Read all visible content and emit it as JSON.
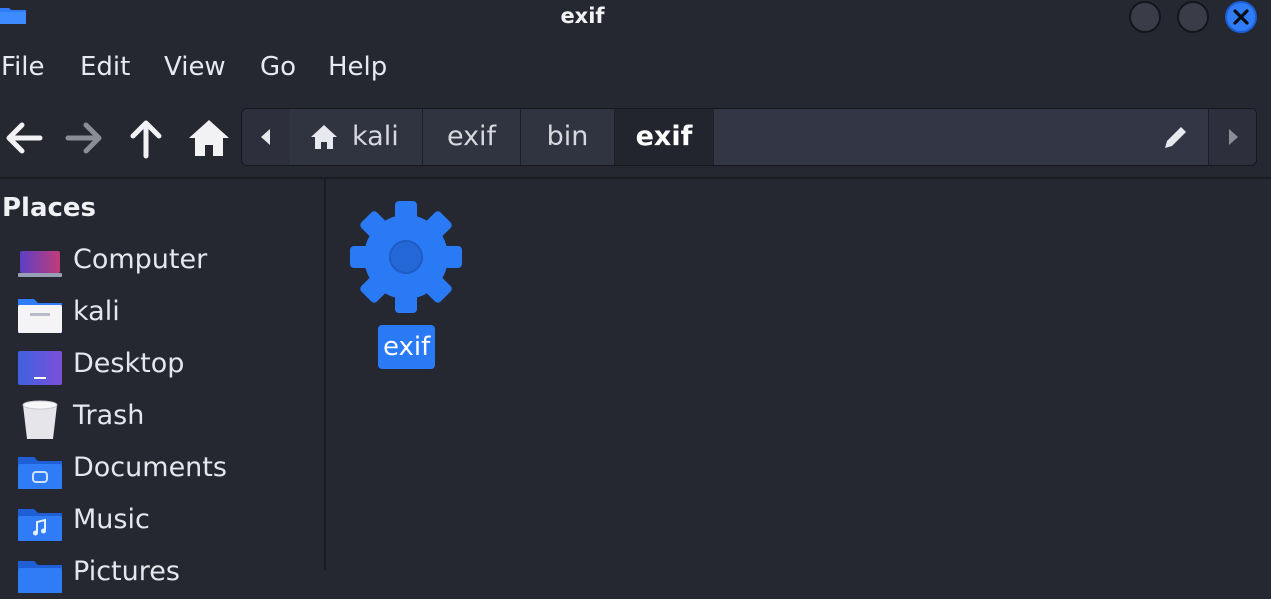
{
  "window": {
    "title": "exif"
  },
  "menu": {
    "file": "File",
    "edit": "Edit",
    "view": "View",
    "go": "Go",
    "help": "Help"
  },
  "path": {
    "segments": [
      {
        "label": "kali",
        "icon": "home-icon"
      },
      {
        "label": "exif"
      },
      {
        "label": "bin"
      },
      {
        "label": "exif",
        "active": true
      }
    ]
  },
  "sidebar": {
    "title": "Places",
    "items": [
      {
        "label": "Computer",
        "icon": "computer-icon"
      },
      {
        "label": "kali",
        "icon": "home-folder-icon"
      },
      {
        "label": "Desktop",
        "icon": "desktop-icon"
      },
      {
        "label": "Trash",
        "icon": "trash-icon"
      },
      {
        "label": "Documents",
        "icon": "documents-folder-icon"
      },
      {
        "label": "Music",
        "icon": "music-folder-icon"
      },
      {
        "label": "Pictures",
        "icon": "pictures-folder-icon"
      }
    ]
  },
  "files": [
    {
      "name": "exif",
      "icon": "executable-gear-icon",
      "selected": true
    }
  ],
  "colors": {
    "accent": "#2b7af5",
    "background": "#252731"
  }
}
